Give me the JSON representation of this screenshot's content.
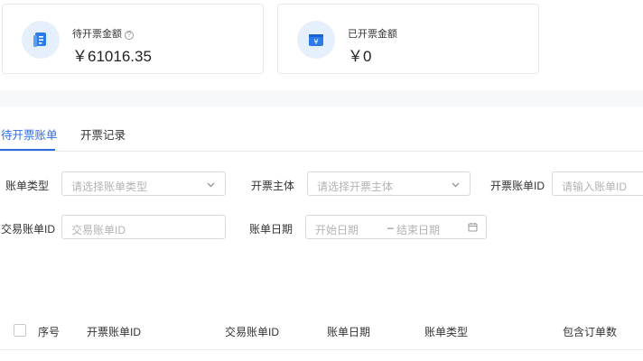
{
  "summary": {
    "pending": {
      "label": "待开票金额",
      "value": "￥61016.35",
      "icon": "invoice-document-icon",
      "help_icon": "?"
    },
    "issued": {
      "label": "已开票金额",
      "value": "￥0",
      "icon": "yuan-wallet-icon"
    }
  },
  "tabs": [
    {
      "label": "待开票账单",
      "active": true
    },
    {
      "label": "开票记录",
      "active": false
    }
  ],
  "filters": {
    "bill_type": {
      "label": "账单类型",
      "placeholder": "请选择账单类型"
    },
    "invoice_entity": {
      "label": "开票主体",
      "placeholder": "请选择开票主体"
    },
    "invoice_bill_id": {
      "label": "开票账单ID",
      "placeholder": "请输入账单ID"
    },
    "trade_bill_id": {
      "label": "交易账单ID",
      "placeholder": "交易账单ID"
    },
    "bill_date": {
      "label": "账单日期",
      "start_placeholder": "开始日期",
      "separator": "–",
      "end_placeholder": "结束日期"
    }
  },
  "table": {
    "columns": [
      "序号",
      "开票账单ID",
      "交易账单ID",
      "账单日期",
      "账单类型",
      "包含订单数"
    ]
  },
  "colors": {
    "accent": "#2b6ce6",
    "icon_bg": "#e6f0fc"
  }
}
